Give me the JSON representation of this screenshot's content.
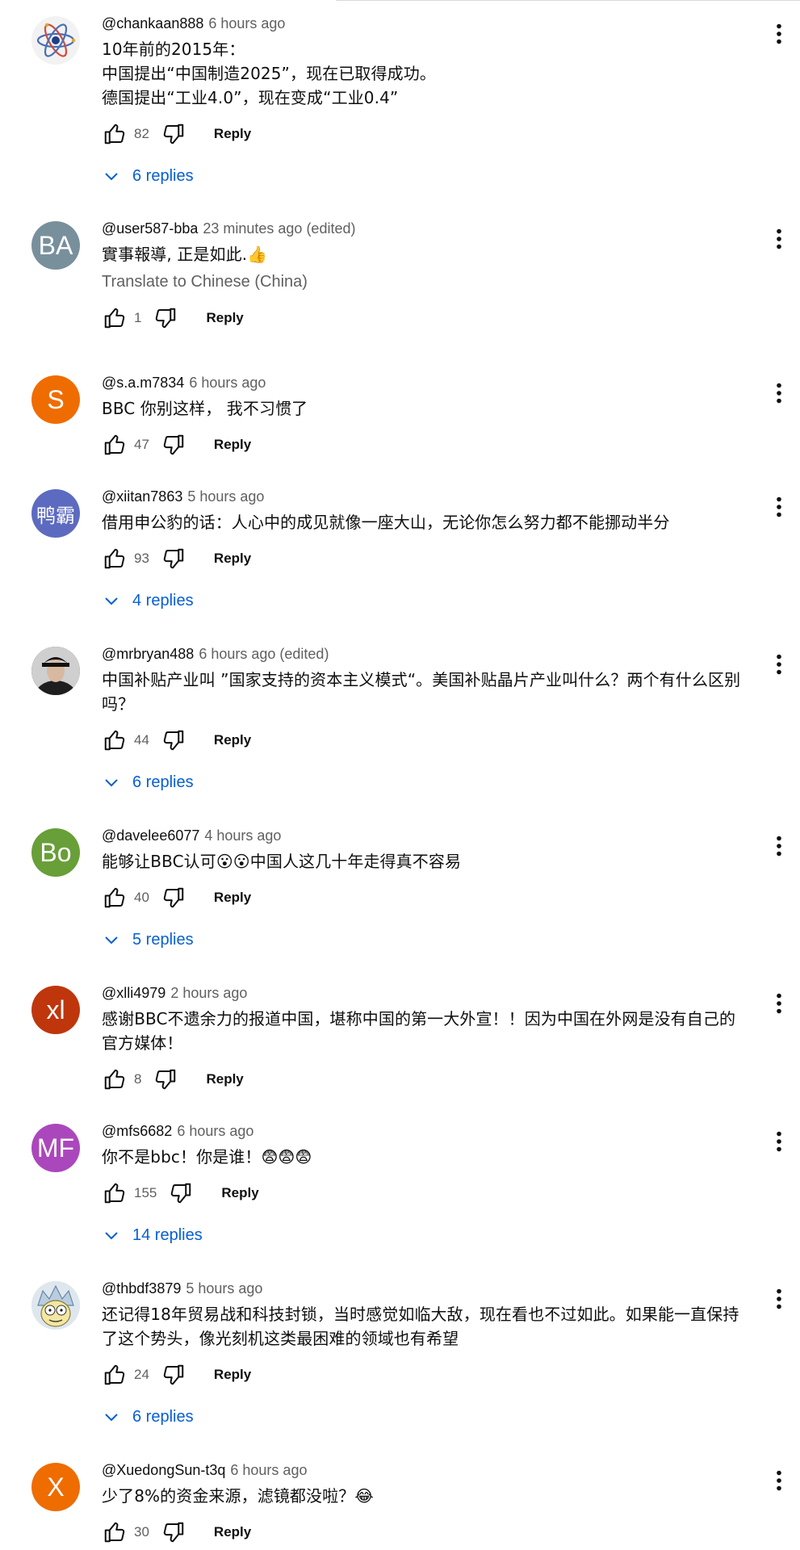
{
  "comments": [
    {
      "handle": "@chankaan888",
      "time": "6 hours ago",
      "text": "10年前的2015年：\n中国提出“中国制造2025”，现在已取得成功。\n德国提出“工业4.0”，现在变成“工业0.4”",
      "likes": "82",
      "reply_label": "Reply",
      "replies_label": "6 replies",
      "avatar": {
        "type": "image",
        "icon": "atom-logo-icon"
      }
    },
    {
      "handle": "@user587-bba",
      "time": "23 minutes ago (edited)",
      "text": "實事報導, 正是如此.👍",
      "translate": "Translate to Chinese (China)",
      "likes": "1",
      "reply_label": "Reply",
      "avatar": {
        "type": "initials",
        "initials": "BA",
        "color": "#78909c"
      }
    },
    {
      "handle": "@s.a.m7834",
      "time": "6 hours ago",
      "text": "BBC 你别这样，  我不习惯了",
      "likes": "47",
      "reply_label": "Reply",
      "avatar": {
        "type": "initials",
        "initials": "S",
        "color": "#ef6c00"
      }
    },
    {
      "handle": "@xiitan7863",
      "time": "5 hours ago",
      "text": "借用申公豹的话：人心中的成见就像一座大山，无论你怎么努力都不能挪动半分",
      "likes": "93",
      "reply_label": "Reply",
      "replies_label": "4 replies",
      "avatar": {
        "type": "initials",
        "initials": "鸭霸",
        "color": "#5c6bc0"
      }
    },
    {
      "handle": "@mrbryan488",
      "time": "6 hours ago (edited)",
      "text": "中国补贴产业叫 ”国家支持的资本主义模式“。美国补贴晶片产业叫什么？两个有什么区别吗？",
      "likes": "44",
      "reply_label": "Reply",
      "replies_label": "6 replies",
      "avatar": {
        "type": "image",
        "icon": "person-photo-icon"
      }
    },
    {
      "handle": "@davelee6077",
      "time": "4 hours ago",
      "text": "能够让BBC认可😮😮中国人这几十年走得真不容易",
      "likes": "40",
      "reply_label": "Reply",
      "replies_label": "5 replies",
      "avatar": {
        "type": "initials",
        "initials": "Bo",
        "color": "#689f38"
      }
    },
    {
      "handle": "@xlli4979",
      "time": "2 hours ago",
      "text": "感谢BBC不遗余力的报道中国，堪称中国的第一大外宣！！因为中国在外网是没有自己的官方媒体！",
      "likes": "8",
      "reply_label": "Reply",
      "avatar": {
        "type": "initials",
        "initials": "xl",
        "color": "#bf360c"
      }
    },
    {
      "handle": "@mfs6682",
      "time": "6 hours ago",
      "text": "你不是bbc！你是谁！😨😨😨",
      "likes": "155",
      "reply_label": "Reply",
      "replies_label": "14 replies",
      "avatar": {
        "type": "initials",
        "initials": "MF",
        "color": "#ab47bc"
      }
    },
    {
      "handle": "@thbdf3879",
      "time": "5 hours ago",
      "text": "还记得18年贸易战和科技封锁，当时感觉如临大敌，现在看也不过如此。如果能一直保持了这个势头，像光刻机这类最困难的领域也有希望",
      "likes": "24",
      "reply_label": "Reply",
      "replies_label": "6 replies",
      "avatar": {
        "type": "image",
        "icon": "cartoon-avatar-icon"
      }
    },
    {
      "handle": "@XuedongSun-t3q",
      "time": "6 hours ago",
      "text": "少了8%的资金来源，滤镜都没啦？😂",
      "likes": "30",
      "reply_label": "Reply",
      "avatar": {
        "type": "initials",
        "initials": "X",
        "color": "#ef6c00"
      }
    }
  ],
  "colors": {
    "link_blue": "#065fd4",
    "meta_gray": "#606060",
    "text": "#0f0f0f"
  }
}
